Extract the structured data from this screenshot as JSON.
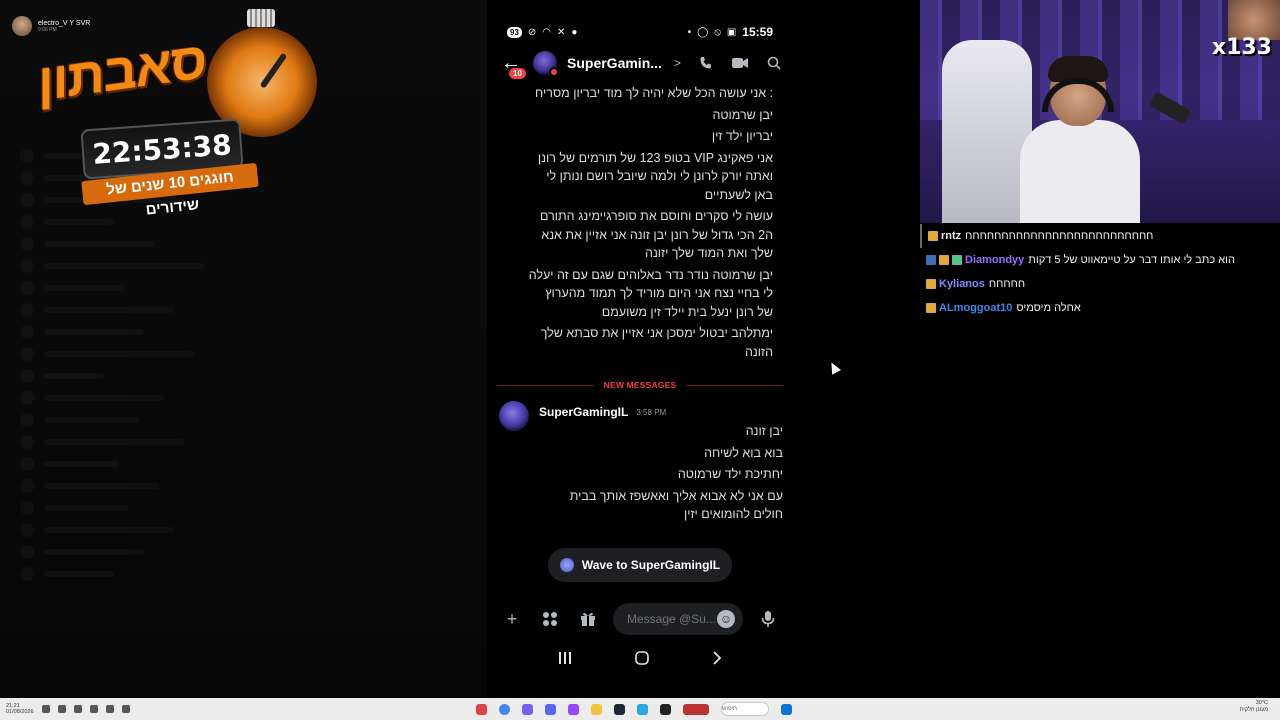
{
  "stream": {
    "streamer_name": "electro_V",
    "streamer_badge": "Y SVR",
    "streamer_subtext": "9:06 PM",
    "logo_title": "סאבתון",
    "timer": "22:53:38",
    "logo_tagline": "חוגגים 10 שנים של שידורים",
    "webcam_overlay": "x133"
  },
  "twitch_chat": [
    {
      "user": "rntz",
      "user_color": "#efeff1",
      "message": "חחחחחחחחחחחחחחחחחחחחחחחחחח"
    },
    {
      "user": "Diamondyy",
      "user_color": "#9b6bff",
      "message": "הוא כתב לי אותו דבר על טיימאווט של 5 דקות"
    },
    {
      "user": "Kylianos",
      "user_color": "#7c8cff",
      "message": "חחחחח"
    },
    {
      "user": "ALmoggoat10",
      "user_color": "#3c86e6",
      "message": "אחלה מיסמיס"
    }
  ],
  "phone": {
    "status": {
      "battery": "93",
      "time": "15:59"
    },
    "header": {
      "back_label": "←",
      "unread_count": "10",
      "dm_name": "SuperGamin...",
      "chevron": ">"
    },
    "earlier_messages": [
      ": אני עושה הכל שלא יהיה לך מוד יבריון מסריח",
      "יבן שרמוטה",
      "יבריון ילד זין",
      "אני פאקינג VIP בטופ 123 של תורמים של רונן ואתה יורק לרונן לי ולמה שיובל רושם ונותן לי באן לשעתיים",
      "עושה לי סקרים וחוסם את סופרגיימינג התורם ה2 הכי גדול של רונן יבן זונה אני אזיין את אנא שלך ואת המוד שלך יזונה",
      "יבן שרמוטה נודר נדר באלוהים שגם עם זה יעלה לי בחיי נצח אני היום מוריד לך תמוד מהערוץ של רונן ינעל בית יילד זין משועמם",
      "ימתלהב יבטול ימסכן אני אזיין את סבתא שלך הזונה"
    ],
    "divider_label": "NEW MESSAGES",
    "new_group": {
      "author": "SuperGamingIL",
      "time": "3:58 PM",
      "messages": [
        "יבן זונה",
        "בוא בוא לשיחה",
        "יחתיכת ילד שרמוטה",
        "עם אני לא אבוא אליך ואאשפז אותך בבית חולים להומואים יזין"
      ]
    },
    "wave_label": "Wave to SuperGamingIL",
    "composer": {
      "placeholder": "Message @Su..."
    }
  },
  "taskbar": {
    "left_time": "21:21",
    "left_date": "01/08/2026",
    "search_label": "חיפוש",
    "right_temp": "30°C",
    "right_weather": "מעונן חלקית"
  }
}
